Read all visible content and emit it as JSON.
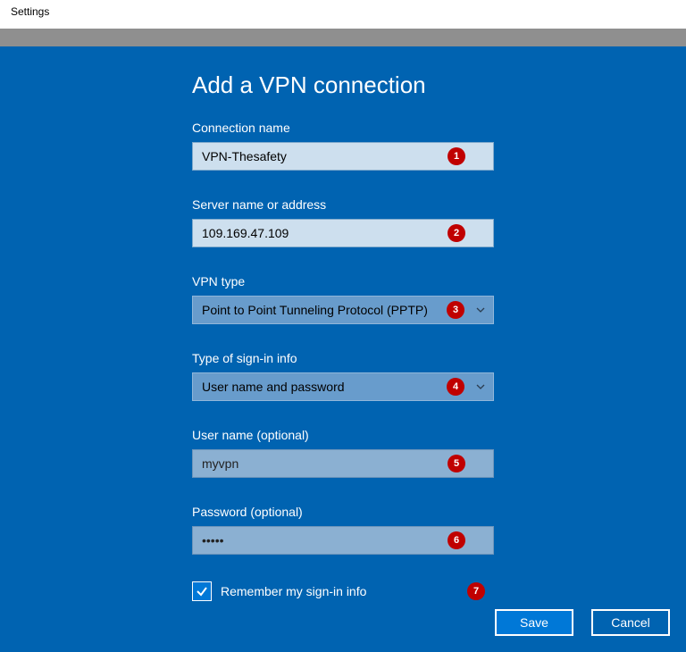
{
  "window": {
    "title": "Settings"
  },
  "page": {
    "heading": "Add a VPN connection",
    "fields": {
      "connection_name": {
        "label": "Connection name",
        "value": "VPN-Thesafety",
        "badge": "1"
      },
      "server": {
        "label": "Server name or address",
        "value": "109.169.47.109",
        "badge": "2"
      },
      "vpn_type": {
        "label": "VPN type",
        "value": "Point to Point Tunneling Protocol (PPTP)",
        "badge": "3"
      },
      "signin_type": {
        "label": "Type of sign-in info",
        "value": "User name and password",
        "badge": "4"
      },
      "username": {
        "label": "User name (optional)",
        "value": "myvpn",
        "badge": "5"
      },
      "password": {
        "label": "Password (optional)",
        "value": "•••••",
        "badge": "6"
      }
    },
    "remember": {
      "label": "Remember my sign-in info",
      "checked": true,
      "badge": "7"
    },
    "buttons": {
      "save": "Save",
      "cancel": "Cancel"
    }
  }
}
